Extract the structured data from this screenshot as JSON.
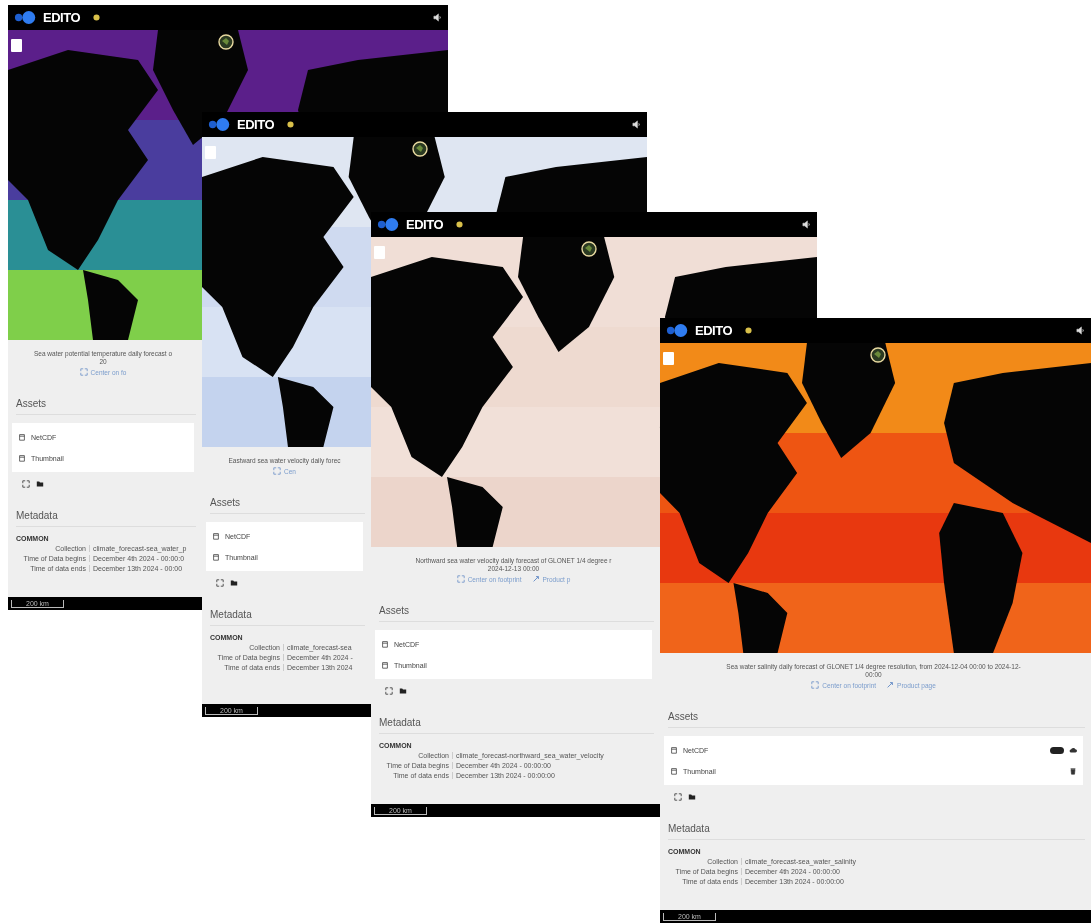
{
  "cards": [
    {
      "brand": "EDITO",
      "description": [
        "Sea water potential temperature daily forecast o",
        "20"
      ],
      "links": [
        {
          "kind": "footprint",
          "label": "Center on fo"
        }
      ],
      "assets_title": "Assets",
      "assets": [
        {
          "name": "NetCDF"
        },
        {
          "name": "Thumbnail"
        }
      ],
      "metadata_title": "Metadata",
      "metadata_group": "COMMON",
      "metadata": [
        {
          "label": "Collection",
          "value": "climate_forecast-sea_water_p"
        },
        {
          "label": "Time of Data begins",
          "value": "December 4th 2024 - 00:00:0"
        },
        {
          "label": "Time of data ends",
          "value": "December 13th 2024 - 00:00"
        }
      ],
      "scale": "200 km"
    },
    {
      "brand": "EDITO",
      "description": [
        "Eastward sea water velocity daily forec"
      ],
      "links": [
        {
          "kind": "footprint",
          "label": "Cen"
        }
      ],
      "assets_title": "Assets",
      "assets": [
        {
          "name": "NetCDF"
        },
        {
          "name": "Thumbnail"
        }
      ],
      "metadata_title": "Metadata",
      "metadata_group": "COMMON",
      "metadata": [
        {
          "label": "Collection",
          "value": "climate_forecast-sea"
        },
        {
          "label": "Time of Data begins",
          "value": "December 4th 2024 -"
        },
        {
          "label": "Time of data ends",
          "value": "December 13th 2024"
        }
      ],
      "scale": "200 km"
    },
    {
      "brand": "EDITO",
      "description": [
        "Northward sea water velocity daily forecast of GLONET 1/4 degree r",
        "2024-12-13 00:00"
      ],
      "links": [
        {
          "kind": "footprint",
          "label": "Center on footprint"
        },
        {
          "kind": "link",
          "label": "Product p"
        }
      ],
      "assets_title": "Assets",
      "assets": [
        {
          "name": "NetCDF"
        },
        {
          "name": "Thumbnail"
        }
      ],
      "metadata_title": "Metadata",
      "metadata_group": "COMMON",
      "metadata": [
        {
          "label": "Collection",
          "value": "climate_forecast-northward_sea_water_velocity"
        },
        {
          "label": "Time of Data begins",
          "value": "December 4th 2024 - 00:00:00"
        },
        {
          "label": "Time of data ends",
          "value": "December 13th 2024 - 00:00:00"
        }
      ],
      "scale": "200 km"
    },
    {
      "brand": "EDITO",
      "description": [
        "Sea water salinity daily forecast of GLONET 1/4 degree resolution, from 2024-12-04 00:00 to 2024-12-",
        "00:00"
      ],
      "links": [
        {
          "kind": "footprint",
          "label": "Center on footprint"
        },
        {
          "kind": "link",
          "label": "Product page"
        }
      ],
      "assets_title": "Assets",
      "assets": [
        {
          "name": "NetCDF",
          "actions": [
            {
              "kind": "badge"
            },
            {
              "kind": "cloud"
            }
          ]
        },
        {
          "name": "Thumbnail",
          "actions": [
            {
              "kind": "trash"
            }
          ]
        }
      ],
      "metadata_title": "Metadata",
      "metadata_group": "COMMON",
      "metadata": [
        {
          "label": "Collection",
          "value": "climate_forecast-sea_water_salinity"
        },
        {
          "label": "Time of Data begins",
          "value": "December 4th 2024 - 00:00:00"
        },
        {
          "label": "Time of data ends",
          "value": "December 13th 2024 - 00:00:00"
        }
      ],
      "scale": "200 km"
    }
  ]
}
